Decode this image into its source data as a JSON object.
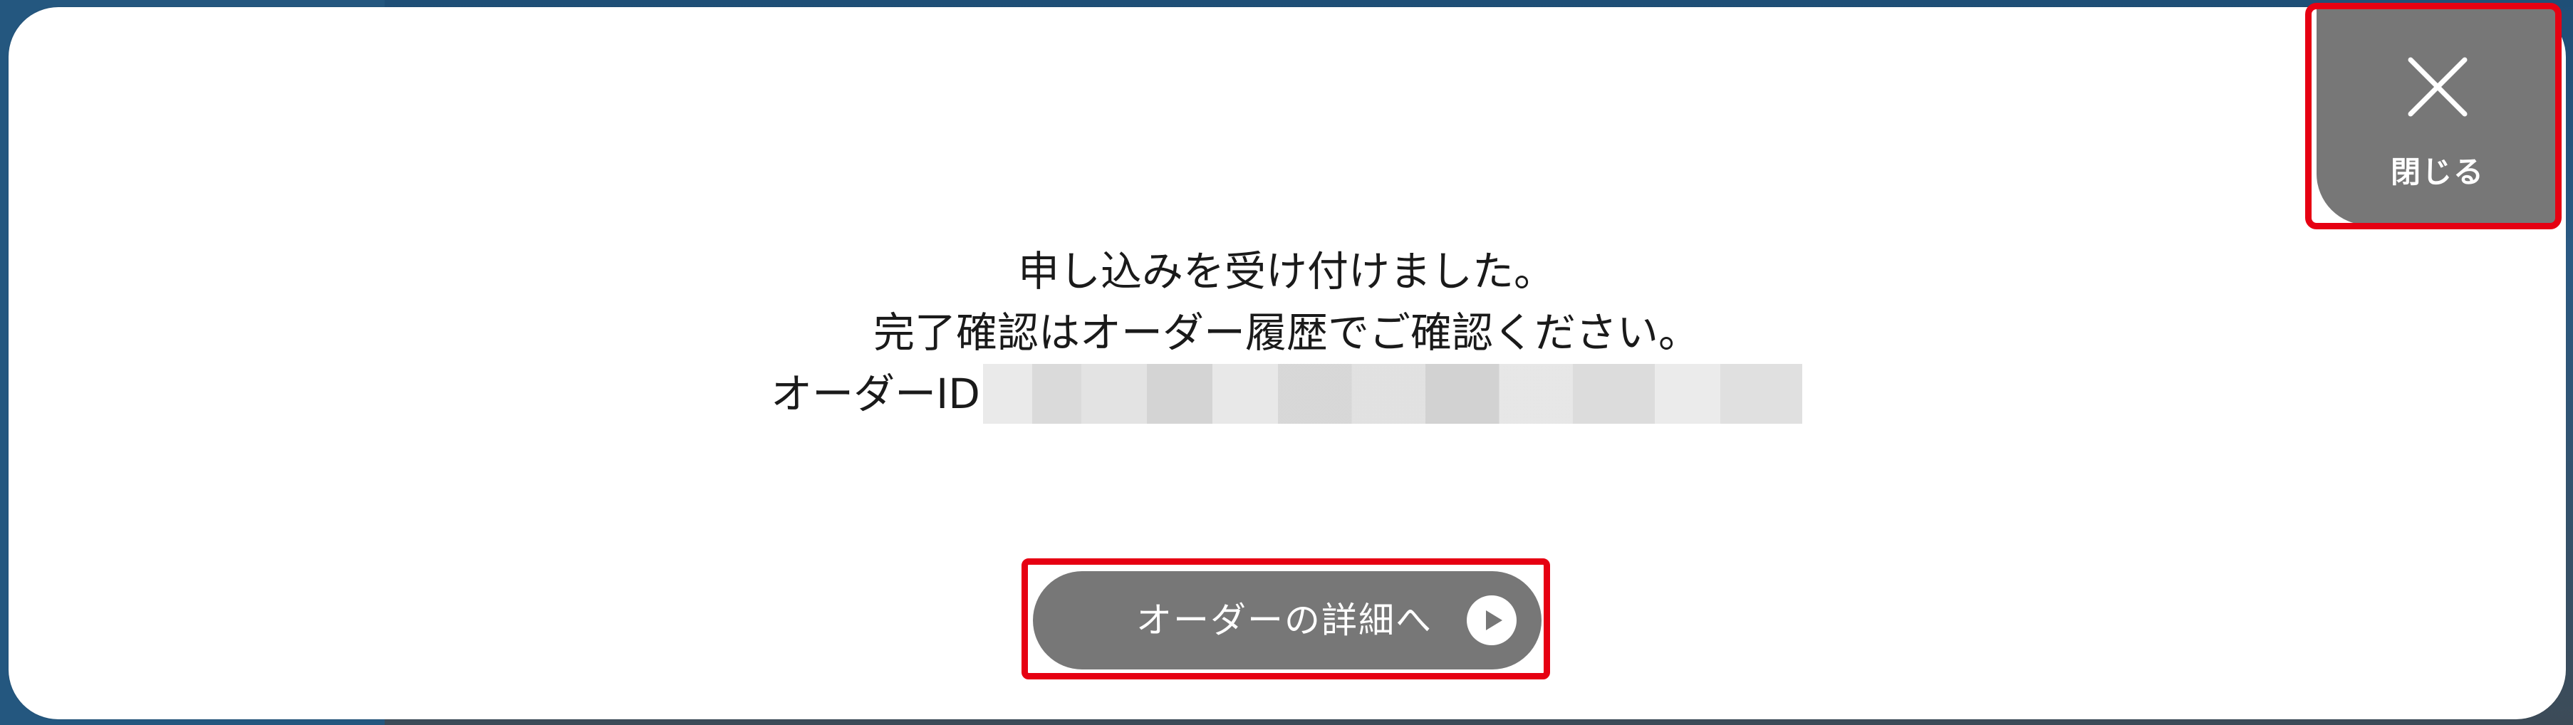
{
  "dialog": {
    "message_line1": "申し込みを受け付けました。",
    "message_line2": "完了確認はオーダー履歴でご確認ください。",
    "order_id_label": "オーダーID",
    "close_label": "閉じる",
    "detail_button_label": "オーダーの詳細へ"
  },
  "icons": {
    "close": "close-icon",
    "detail": "play-circle-icon"
  },
  "colors": {
    "button_bg": "#777777",
    "button_text": "#ffffff",
    "highlight": "#e60012",
    "text": "#1a1a1a"
  }
}
